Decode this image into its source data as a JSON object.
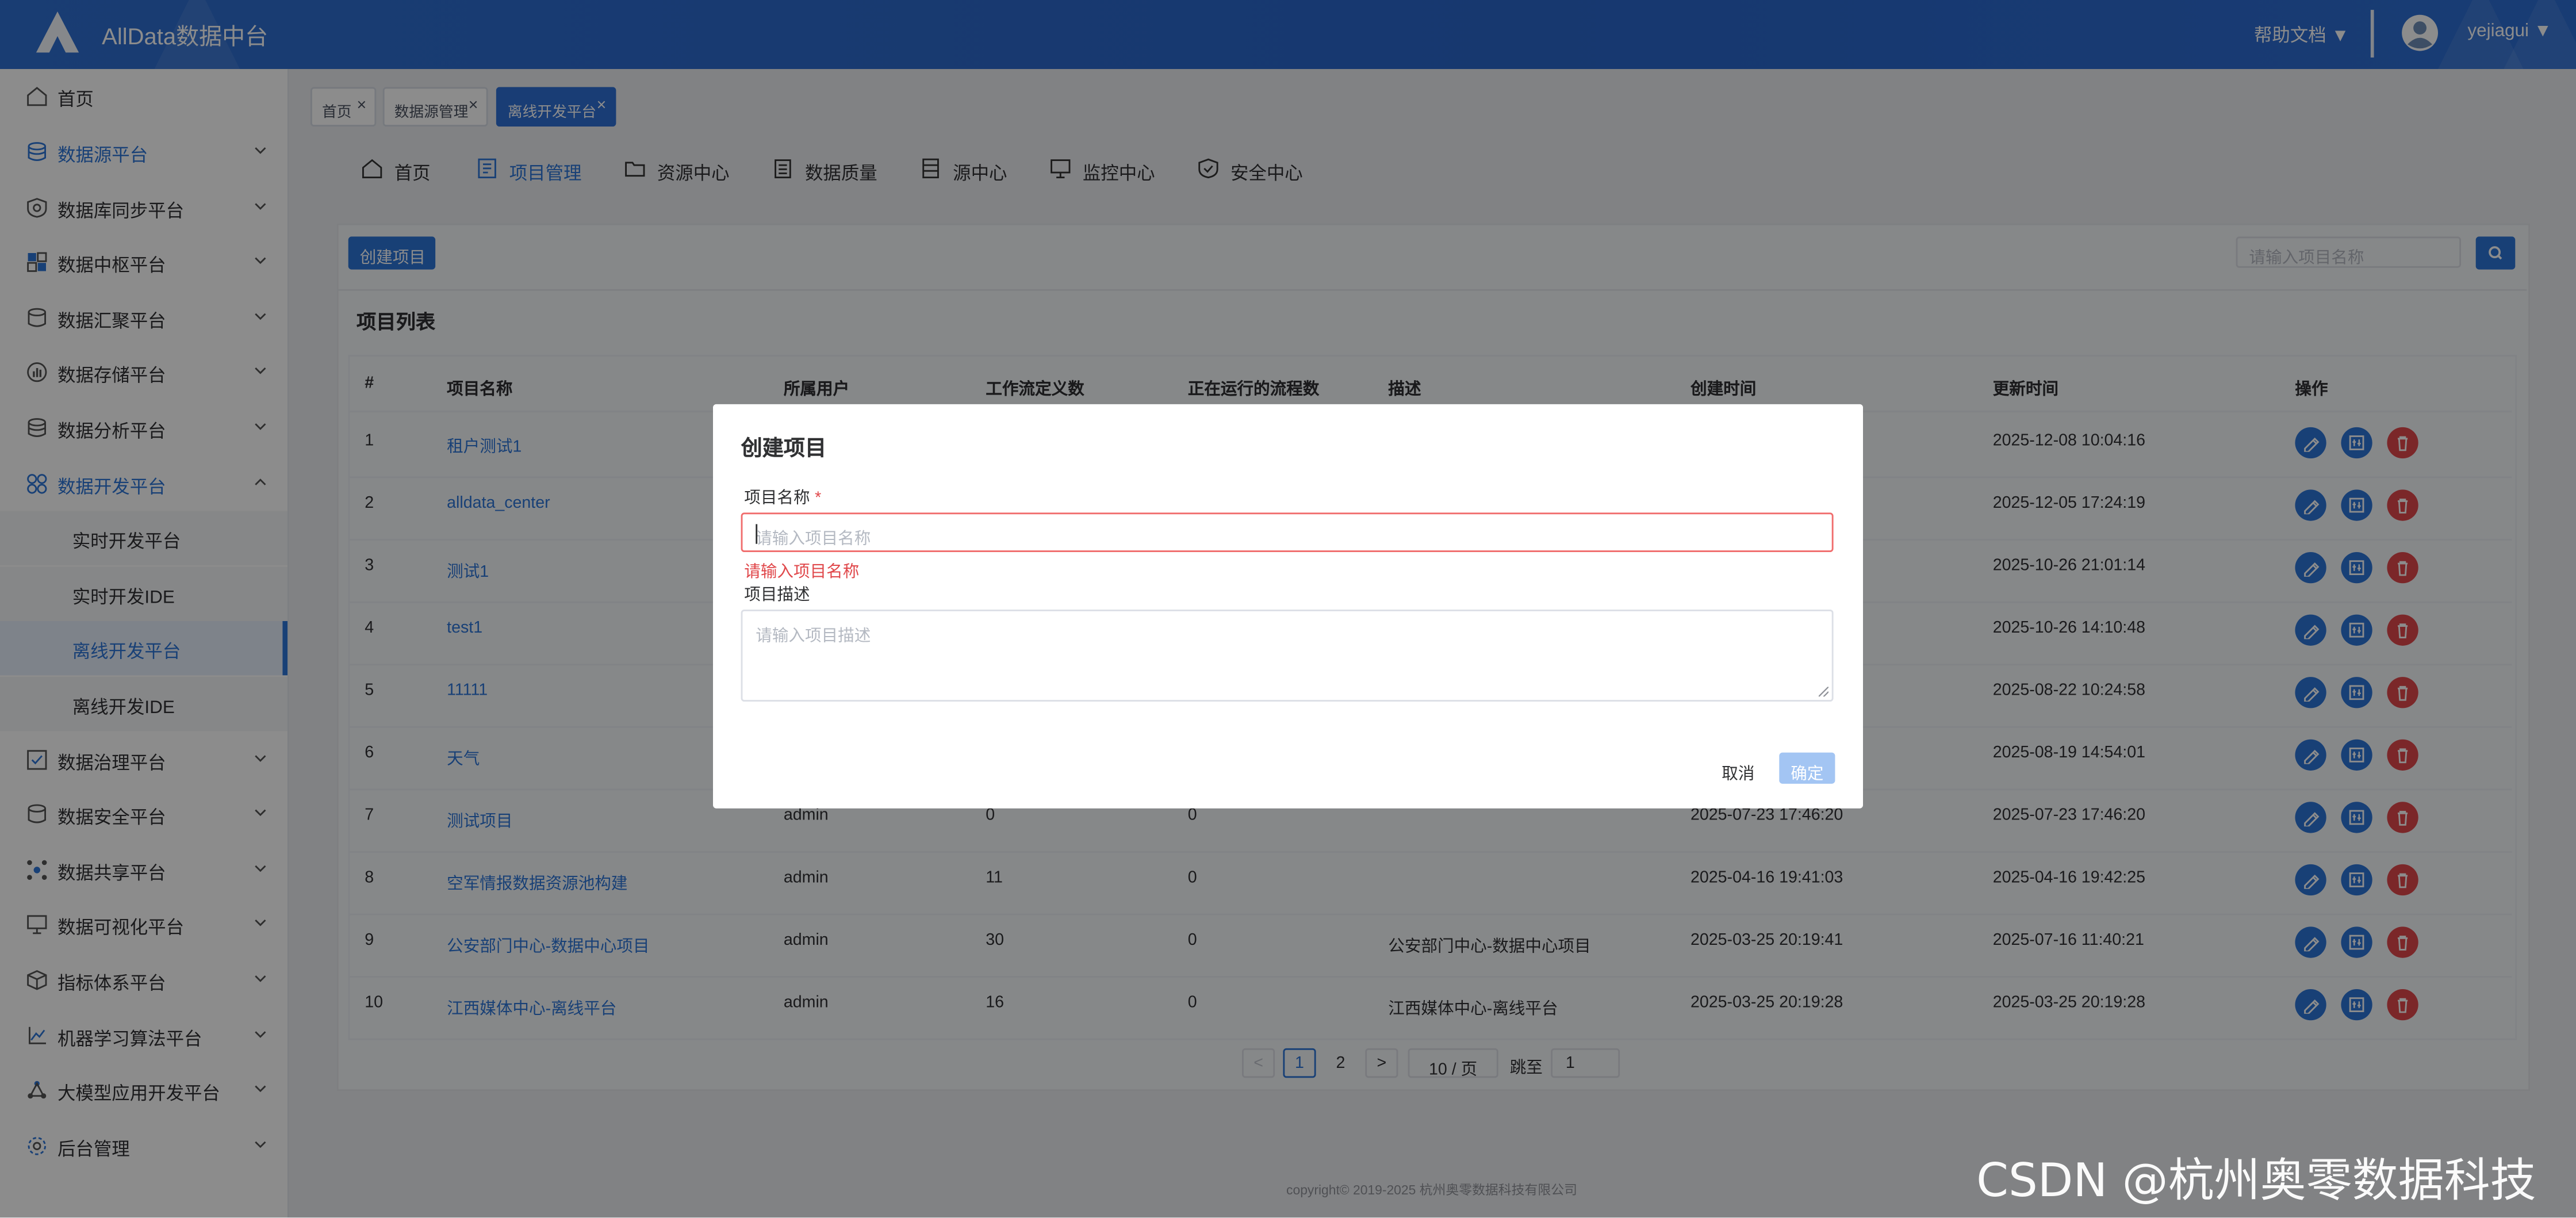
{
  "header": {
    "app_title": "AllData数据中台",
    "help": "帮助文档 ▼",
    "user": "yejiagui ▼"
  },
  "sidebar": {
    "items": [
      {
        "label": "首页",
        "icon": "home-icon"
      },
      {
        "label": "数据源平台",
        "icon": "database-icon"
      },
      {
        "label": "数据库同步平台",
        "icon": "sync-icon"
      },
      {
        "label": "数据中枢平台",
        "icon": "grid-icon"
      },
      {
        "label": "数据汇聚平台",
        "icon": "layers-icon"
      },
      {
        "label": "数据存储平台",
        "icon": "storage-icon"
      },
      {
        "label": "数据分析平台",
        "icon": "analysis-icon"
      },
      {
        "label": "数据开发平台",
        "icon": "dev-icon"
      }
    ],
    "subitems": [
      "实时开发平台",
      "实时开发IDE",
      "离线开发平台",
      "离线开发IDE"
    ],
    "items_after": [
      {
        "label": "数据治理平台",
        "icon": "governance-icon"
      },
      {
        "label": "数据安全平台",
        "icon": "security-icon"
      },
      {
        "label": "数据共享平台",
        "icon": "share-icon"
      },
      {
        "label": "数据可视化平台",
        "icon": "monitor-icon"
      },
      {
        "label": "指标体系平台",
        "icon": "cube-icon"
      },
      {
        "label": "机器学习算法平台",
        "icon": "ml-icon"
      },
      {
        "label": "大模型应用开发平台",
        "icon": "llm-icon"
      },
      {
        "label": "后台管理",
        "icon": "settings-icon"
      }
    ]
  },
  "tags": [
    {
      "label": "首页"
    },
    {
      "label": "数据源管理"
    },
    {
      "label": "离线开发平台"
    }
  ],
  "tag_close": "×",
  "tabs": [
    "首页",
    "项目管理",
    "资源中心",
    "数据质量",
    "源中心",
    "监控中心",
    "安全中心"
  ],
  "toolbar": {
    "create_label": "创建项目",
    "search_placeholder": "请输入项目名称"
  },
  "list": {
    "title": "项目列表",
    "columns": [
      "#",
      "项目名称",
      "所属用户",
      "工作流定义数",
      "正在运行的流程数",
      "描述",
      "创建时间",
      "更新时间",
      "操作"
    ],
    "rows": [
      {
        "no": "1",
        "name": "租户测试1",
        "user": "",
        "defs": "",
        "running": "",
        "desc": "",
        "created": "",
        "updated": "2025-12-08 10:04:16"
      },
      {
        "no": "2",
        "name": "alldata_center",
        "user": "",
        "defs": "",
        "running": "",
        "desc": "",
        "created": "",
        "updated": "2025-12-05 17:24:19"
      },
      {
        "no": "3",
        "name": "测试1",
        "user": "",
        "defs": "",
        "running": "",
        "desc": "",
        "created": "",
        "updated": "2025-10-26 21:01:14"
      },
      {
        "no": "4",
        "name": "test1",
        "user": "",
        "defs": "",
        "running": "",
        "desc": "",
        "created": "",
        "updated": "2025-10-26 14:10:48"
      },
      {
        "no": "5",
        "name": "11111",
        "user": "",
        "defs": "",
        "running": "",
        "desc": "",
        "created": "",
        "updated": "2025-08-22 10:24:58"
      },
      {
        "no": "6",
        "name": "天气",
        "user": "",
        "defs": "",
        "running": "",
        "desc": "",
        "created": "",
        "updated": "2025-08-19 14:54:01"
      },
      {
        "no": "7",
        "name": "测试项目",
        "user": "admin",
        "defs": "0",
        "running": "0",
        "desc": "",
        "created": "2025-07-23 17:46:20",
        "updated": "2025-07-23 17:46:20"
      },
      {
        "no": "8",
        "name": "空军情报数据资源池构建",
        "user": "admin",
        "defs": "11",
        "running": "0",
        "desc": "",
        "created": "2025-04-16 19:41:03",
        "updated": "2025-04-16 19:42:25"
      },
      {
        "no": "9",
        "name": "公安部门中心-数据中心项目",
        "user": "admin",
        "defs": "30",
        "running": "0",
        "desc": "公安部门中心-数据中心项目",
        "created": "2025-03-25 20:19:41",
        "updated": "2025-07-16 11:40:21"
      },
      {
        "no": "10",
        "name": "江西媒体中心-离线平台",
        "user": "admin",
        "defs": "16",
        "running": "0",
        "desc": "江西媒体中心-离线平台",
        "created": "2025-03-25 20:19:28",
        "updated": "2025-03-25 20:19:28"
      }
    ]
  },
  "pagination": {
    "prev": "<",
    "pages": [
      "1",
      "2"
    ],
    "current": "1",
    "next": ">",
    "page_size": "10 / 页",
    "goto_label": "跳至",
    "goto_value": "1"
  },
  "footer": "copyright© 2019-2025 杭州奥零数据科技有限公司",
  "watermark": "CSDN @杭州奥零数据科技",
  "dialog": {
    "title": "创建项目",
    "name_label": "项目名称",
    "required_mark": "*",
    "name_placeholder": "请输入项目名称",
    "name_error": "请输入项目名称",
    "desc_label": "项目描述",
    "desc_placeholder": "请输入项目描述",
    "cancel": "取消",
    "ok": "确定"
  },
  "colors": {
    "primary": "#2d75d8",
    "danger": "#e0484b",
    "header": "#2f6fd1"
  }
}
